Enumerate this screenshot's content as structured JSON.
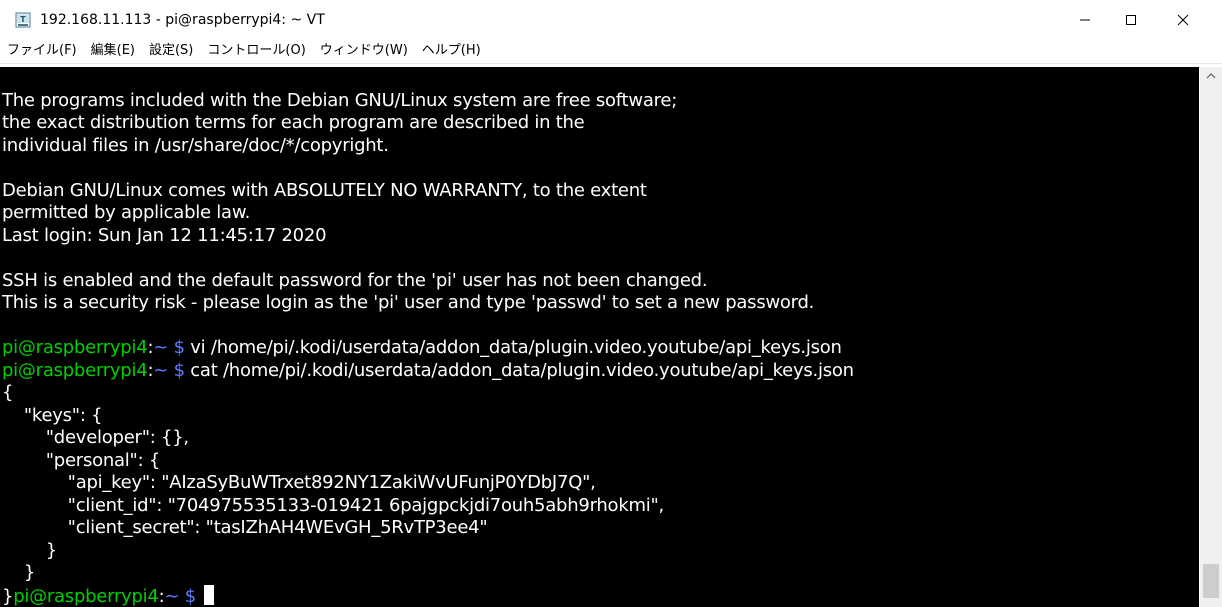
{
  "window": {
    "title": "192.168.11.113 - pi@raspberrypi4: ~ VT",
    "icon": "teraterm-icon",
    "controls": {
      "minimize": "minimize-icon",
      "maximize": "maximize-icon",
      "close": "close-icon"
    }
  },
  "menu": {
    "items": [
      {
        "label": "ファイル(F)"
      },
      {
        "label": "編集(E)"
      },
      {
        "label": "設定(S)"
      },
      {
        "label": "コントロール(O)"
      },
      {
        "label": "ウィンドウ(W)"
      },
      {
        "label": "ヘルプ(H)"
      }
    ]
  },
  "terminal": {
    "lines": [
      {
        "text": ""
      },
      {
        "text": "The programs included with the Debian GNU/Linux system are free software;"
      },
      {
        "text": "the exact distribution terms for each program are described in the"
      },
      {
        "text": "individual files in /usr/share/doc/*/copyright."
      },
      {
        "text": ""
      },
      {
        "text": "Debian GNU/Linux comes with ABSOLUTELY NO WARRANTY, to the extent"
      },
      {
        "text": "permitted by applicable law."
      },
      {
        "text": "Last login: Sun Jan 12 11:45:17 2020"
      },
      {
        "text": ""
      },
      {
        "text": "SSH is enabled and the default password for the 'pi' user has not been changed."
      },
      {
        "text": "This is a security risk - please login as the 'pi' user and type 'passwd' to set a new password."
      },
      {
        "text": ""
      }
    ],
    "prompt_lines": [
      {
        "prefix": "",
        "user": "pi@raspberrypi4",
        "sep": ":",
        "path": "~",
        "dollar": " $",
        "command": " vi /home/pi/.kodi/userdata/addon_data/plugin.video.youtube/api_keys.json"
      },
      {
        "prefix": "",
        "user": "pi@raspberrypi4",
        "sep": ":",
        "path": "~",
        "dollar": " $",
        "command": " cat /home/pi/.kodi/userdata/addon_data/plugin.video.youtube/api_keys.json"
      }
    ],
    "json_lines": [
      {
        "text": "{"
      },
      {
        "text": "    \"keys\": {"
      },
      {
        "text": "        \"developer\": {},"
      },
      {
        "text": "        \"personal\": {"
      },
      {
        "text": "            \"api_key\": \"AIzaSyBuWTrxet892NY1ZakiWvUFunjP0YDbJ7Q\","
      },
      {
        "text": "            \"client_id\": \"704975535133-019421 6pajgpckjdi7ouh5abh9rhokmi\","
      },
      {
        "text": "            \"client_secret\": \"tasIZhAH4WEvGH_5RvTP3ee4\""
      },
      {
        "text": "        }"
      },
      {
        "text": "    }"
      }
    ],
    "last_prompt": {
      "prefix": "}",
      "user": "pi@raspberrypi4",
      "sep": ":",
      "path": "~",
      "dollar": " $"
    }
  },
  "colors": {
    "background": "#000000",
    "foreground": "#ffffff",
    "prompt_user": "#00d000",
    "prompt_path": "#5a7cff"
  }
}
